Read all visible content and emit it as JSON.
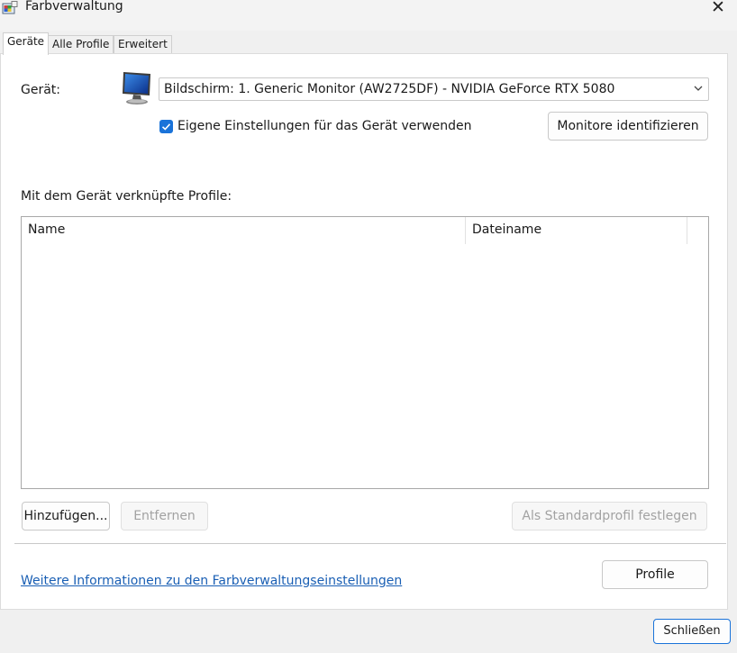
{
  "window": {
    "title": "Farbverwaltung",
    "icon": "color-management-icon",
    "close_icon": "close-icon"
  },
  "tabs": [
    {
      "label": "Geräte",
      "active": true
    },
    {
      "label": "Alle Profile",
      "active": false
    },
    {
      "label": "Erweitert",
      "active": false
    }
  ],
  "device": {
    "label": "Gerät:",
    "icon": "monitor-icon",
    "selected": "Bildschirm: 1. Generic Monitor (AW2725DF) - NVIDIA GeForce RTX 5080",
    "use_own_settings_label": "Eigene Einstellungen für das Gerät verwenden",
    "use_own_settings_checked": true,
    "identify_button": "Monitore identifizieren"
  },
  "profiles": {
    "label": "Mit dem Gerät verknüpfte Profile:",
    "columns": [
      "Name",
      "Dateiname"
    ],
    "rows": []
  },
  "actions": {
    "add": "Hinzufügen...",
    "remove": "Entfernen",
    "set_default": "Als Standardprofil festlegen"
  },
  "footer": {
    "info_link": "Weitere Informationen zu den Farbverwaltungseinstellungen",
    "profile_button": "Profile",
    "close_button": "Schließen"
  },
  "colors": {
    "accent": "#1a73d9",
    "link": "#1a5fb4",
    "disabled_text": "#a2a2a2"
  }
}
